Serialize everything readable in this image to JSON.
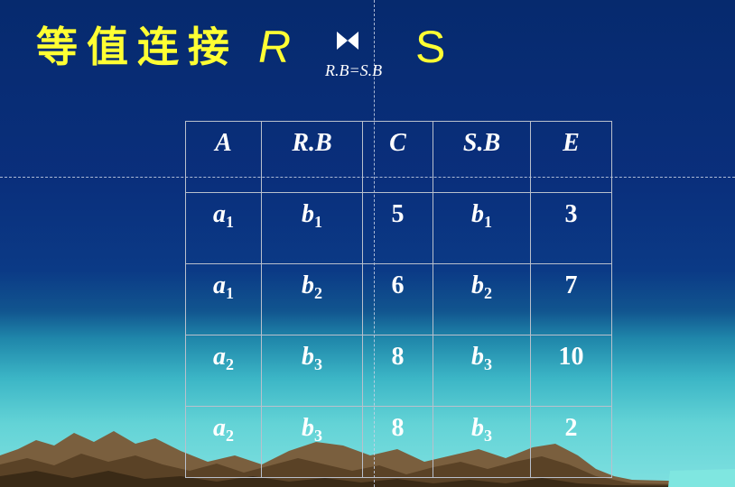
{
  "title": {
    "text": "等值连接",
    "left_relation": "R",
    "right_relation": "S",
    "join_condition": "R.B=S.B"
  },
  "table": {
    "headers": [
      "A",
      "R.B",
      "C",
      "S.B",
      "E"
    ],
    "rows": [
      [
        {
          "base": "a",
          "sub": "1"
        },
        {
          "base": "b",
          "sub": "1"
        },
        {
          "base": "5"
        },
        {
          "base": "b",
          "sub": "1"
        },
        {
          "base": "3"
        }
      ],
      [
        {
          "base": "a",
          "sub": "1"
        },
        {
          "base": "b",
          "sub": "2"
        },
        {
          "base": "6"
        },
        {
          "base": "b",
          "sub": "2"
        },
        {
          "base": "7"
        }
      ],
      [
        {
          "base": "a",
          "sub": "2"
        },
        {
          "base": "b",
          "sub": "3"
        },
        {
          "base": "8"
        },
        {
          "base": "b",
          "sub": "3"
        },
        {
          "base": "10"
        }
      ],
      [
        {
          "base": "a",
          "sub": "2"
        },
        {
          "base": "b",
          "sub": "3"
        },
        {
          "base": "8"
        },
        {
          "base": "b",
          "sub": "3"
        },
        {
          "base": "2"
        }
      ]
    ]
  },
  "colors": {
    "title": "#ffff33",
    "table_text": "#ffffff",
    "table_border": "#b9c0cc",
    "background_top": "#062a6e",
    "background_bottom": "#7fe0e0"
  },
  "icons": {
    "join_symbol": "bowtie-join-icon"
  }
}
